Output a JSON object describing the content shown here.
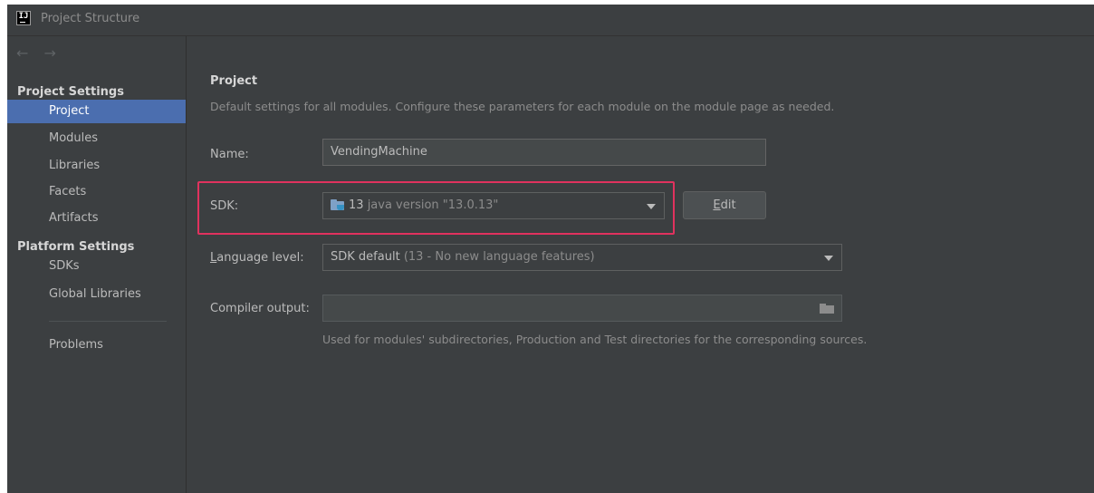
{
  "window": {
    "title": "Project Structure",
    "logo_text": "IJ"
  },
  "sidebar": {
    "nav_back": "←",
    "nav_forward": "→",
    "project_settings_header": "Project Settings",
    "project_settings_items": [
      "Project",
      "Modules",
      "Libraries",
      "Facets",
      "Artifacts"
    ],
    "platform_settings_header": "Platform Settings",
    "platform_settings_items": [
      "SDKs",
      "Global Libraries"
    ],
    "problems_label": "Problems",
    "selected_item": "Project"
  },
  "main": {
    "title": "Project",
    "description": "Default settings for all modules. Configure these parameters for each module on the module page as needed.",
    "name_label": "Name:",
    "name_value": "VendingMachine",
    "sdk_label": "SDK:",
    "sdk_value_primary": "13",
    "sdk_value_secondary": "java version \"13.0.13\"",
    "sdk_icon": "jdk-folder-icon",
    "edit_button_first": "E",
    "edit_button_rest": "dit",
    "language_level_label_first": "L",
    "language_level_label_rest": "anguage level:",
    "language_level_value_primary": "SDK default",
    "language_level_value_secondary": "(13 - No new language features)",
    "compiler_output_label": "Compiler output:",
    "compiler_output_value": "",
    "compiler_output_hint": "Used for modules' subdirectories, Production and Test directories for the corresponding sources."
  },
  "colors": {
    "background": "#3c3f41",
    "selection": "#4b6eaf",
    "highlight_border": "#e0325e"
  }
}
